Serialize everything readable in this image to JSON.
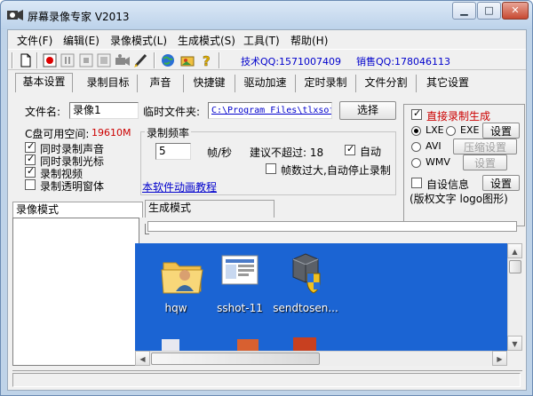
{
  "window": {
    "title": "屏幕录像专家 V2013"
  },
  "menubar": [
    "文件(F)",
    "编辑(E)",
    "录像模式(L)",
    "生成模式(S)",
    "工具(T)",
    "帮助(H)"
  ],
  "toolbar": {
    "icons": [
      "new-icon",
      "record-icon",
      "pause-icon",
      "stop-icon",
      "camera-icon",
      "pen-icon",
      "globe-icon",
      "photo-icon",
      "help-icon"
    ],
    "tech_qq": "技术QQ:1571007409",
    "sales_qq": "销售QQ:178046113"
  },
  "tabs": [
    "基本设置",
    "录制目标",
    "声音",
    "快捷键",
    "驱动加速",
    "定时录制",
    "文件分割",
    "其它设置"
  ],
  "basic": {
    "filename_label": "文件名:",
    "filename_value": "录像1",
    "tempdir_label": "临时文件夹:",
    "tempdir_value": "C:\\Program Files\\tlxsof",
    "choose_button": "选择",
    "disk_label": "C盘可用空间:",
    "disk_value": "19610M",
    "record_sound": "同时录制声音",
    "record_cursor": "同时录制光标",
    "record_video": "录制视频",
    "record_transparent": "录制透明窗体",
    "freq_group": "录制频率",
    "fps_value": "5",
    "fps_unit": "帧/秒",
    "suggest_label": "建议不超过: 18",
    "auto_label": "自动",
    "auto_stop_label": "帧数过大,自动停止录制",
    "tutorial_link": "本软件动画教程"
  },
  "right_panel": {
    "direct_label": "直接录制生成",
    "lxe": "LXE",
    "exe": "EXE",
    "avi": "AVI",
    "wmv": "WMV",
    "settings1": "设置",
    "compress": "压缩设置",
    "settings2": "设置",
    "custom_info": "自设信息",
    "settings3": "设置",
    "copyright": "(版权文字 logo图形)"
  },
  "lower": {
    "record_mode_tab": "录像模式",
    "gen_mode_tab": "生成模式"
  },
  "desktop_icons": [
    {
      "name": "hqw",
      "icon": "user-folder-icon"
    },
    {
      "name": "sshot-11",
      "icon": "screenshot-file-icon"
    },
    {
      "name": "sendtosen...",
      "icon": "server-shield-icon"
    }
  ],
  "colors": {
    "desktop_bg": "#1b64d3",
    "link": "#0000cc",
    "disk_value": "#cc0000",
    "direct_label": "#cc0000"
  }
}
